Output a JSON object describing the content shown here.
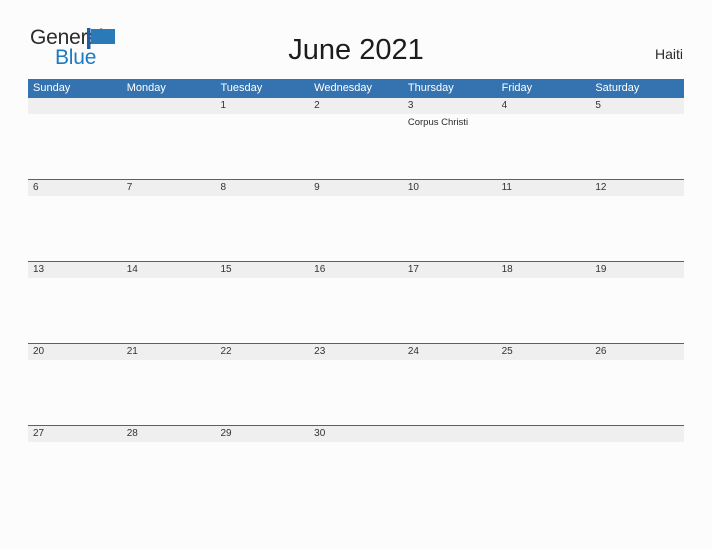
{
  "brand": {
    "name_part1": "General",
    "name_part2": "Blue",
    "flag_icon": "blue-flag-triangle",
    "accent_color": "#1b7ac4"
  },
  "header": {
    "title": "June 2021",
    "country": "Haiti"
  },
  "colors": {
    "header_blue": "#3573b0",
    "row_divider_blue": "#2e6da4",
    "date_band_gray": "#efefef",
    "page_background": "#fcfcfc",
    "logo_blue": "#1b7ac4"
  },
  "calendar": {
    "weekdays": [
      "Sunday",
      "Monday",
      "Tuesday",
      "Wednesday",
      "Thursday",
      "Friday",
      "Saturday"
    ],
    "weeks": [
      {
        "days": [
          {
            "date": "",
            "events": []
          },
          {
            "date": "",
            "events": []
          },
          {
            "date": "1",
            "events": []
          },
          {
            "date": "2",
            "events": []
          },
          {
            "date": "3",
            "events": [
              "Corpus Christi"
            ]
          },
          {
            "date": "4",
            "events": []
          },
          {
            "date": "5",
            "events": []
          }
        ]
      },
      {
        "days": [
          {
            "date": "6",
            "events": []
          },
          {
            "date": "7",
            "events": []
          },
          {
            "date": "8",
            "events": []
          },
          {
            "date": "9",
            "events": []
          },
          {
            "date": "10",
            "events": []
          },
          {
            "date": "11",
            "events": []
          },
          {
            "date": "12",
            "events": []
          }
        ]
      },
      {
        "days": [
          {
            "date": "13",
            "events": []
          },
          {
            "date": "14",
            "events": []
          },
          {
            "date": "15",
            "events": []
          },
          {
            "date": "16",
            "events": []
          },
          {
            "date": "17",
            "events": []
          },
          {
            "date": "18",
            "events": []
          },
          {
            "date": "19",
            "events": []
          }
        ]
      },
      {
        "days": [
          {
            "date": "20",
            "events": []
          },
          {
            "date": "21",
            "events": []
          },
          {
            "date": "22",
            "events": []
          },
          {
            "date": "23",
            "events": []
          },
          {
            "date": "24",
            "events": []
          },
          {
            "date": "25",
            "events": []
          },
          {
            "date": "26",
            "events": []
          }
        ]
      },
      {
        "days": [
          {
            "date": "27",
            "events": []
          },
          {
            "date": "28",
            "events": []
          },
          {
            "date": "29",
            "events": []
          },
          {
            "date": "30",
            "events": []
          },
          {
            "date": "",
            "events": []
          },
          {
            "date": "",
            "events": []
          },
          {
            "date": "",
            "events": []
          }
        ]
      }
    ]
  }
}
